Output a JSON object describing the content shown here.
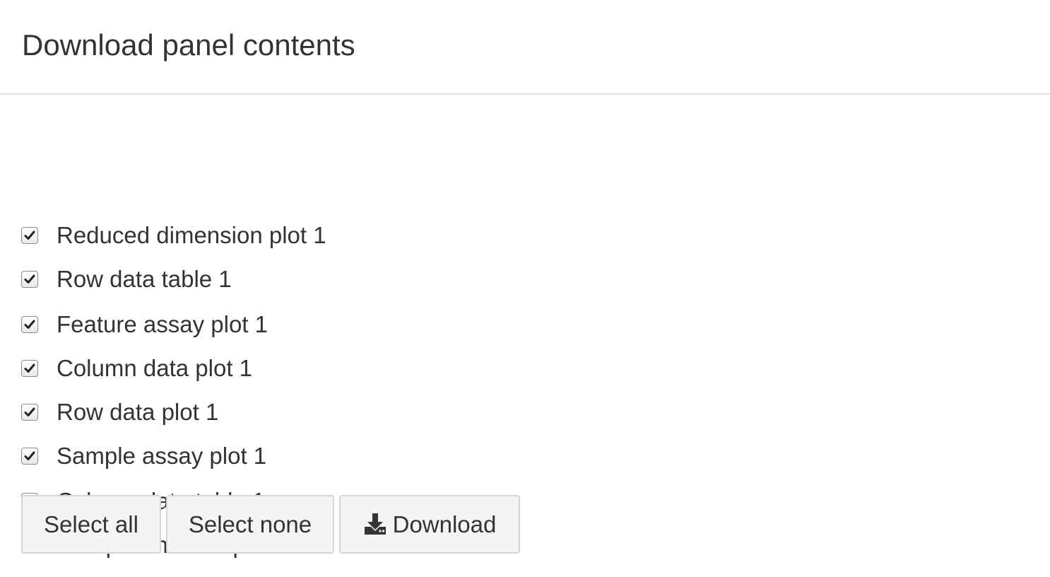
{
  "header": {
    "title": "Download panel contents"
  },
  "panels": [
    {
      "label": "Reduced dimension plot 1",
      "checked": true
    },
    {
      "label": "Row data table 1",
      "checked": true
    },
    {
      "label": "Feature assay plot 1",
      "checked": true
    },
    {
      "label": "Column data plot 1",
      "checked": true
    },
    {
      "label": "Row data plot 1",
      "checked": true
    },
    {
      "label": "Sample assay plot 1",
      "checked": true
    },
    {
      "label": "Column data table 1",
      "checked": true
    },
    {
      "label": "Complex heatmap 1",
      "checked": true
    }
  ],
  "buttons": {
    "select_all": "Select all",
    "select_none": "Select none",
    "download": "Download"
  },
  "icons": {
    "checkmark": "check-icon",
    "download": "download-icon"
  }
}
